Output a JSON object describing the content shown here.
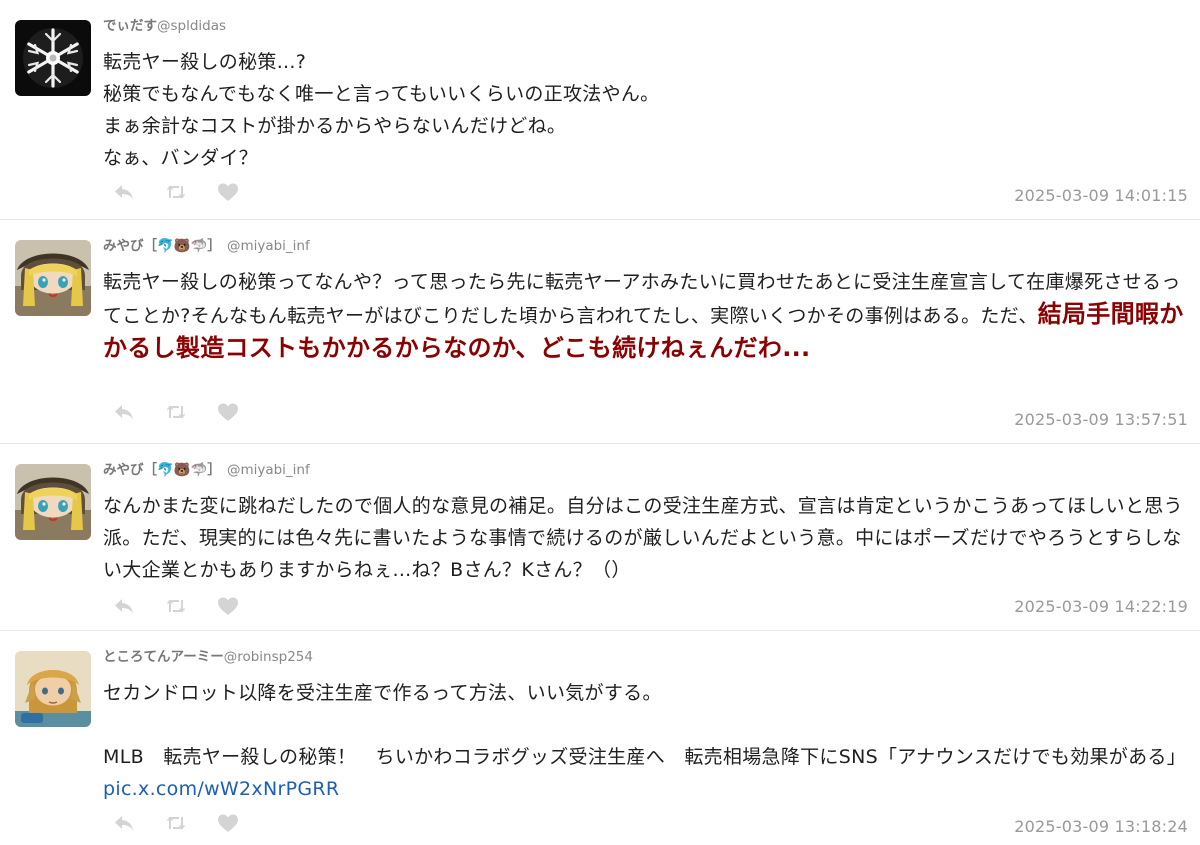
{
  "tweets": [
    {
      "user_name": "でぃだす",
      "user_emoji": "",
      "user_handle": "@spldidas",
      "lines": [
        "転売ヤー殺しの秘策...?",
        "秘策でもなんでもなく唯一と言ってもいいくらいの正攻法やん。",
        "まぁ余計なコストが掛かるからやらないんだけどね。",
        "なぁ、バンダイ？"
      ],
      "timestamp": "2025-03-09 14:01:15"
    },
    {
      "user_name": "みやび",
      "user_emoji": "［🐬🐻🦈］",
      "user_handle": "@miyabi_inf",
      "text_plain": "転売ヤー殺しの秘策ってなんや？って思ったら先に転売ヤーアホみたいに買わせたあとに受注生産宣言して在庫爆死させるってことか?そんなもん転売ヤーがはびこりだした頃から言われてたし、実際いくつかその事例はある。ただ、",
      "text_highlight": "結局手間暇かかるし製造コストもかかるからなのか、どこも続けねぇんだわ...",
      "timestamp": "2025-03-09 13:57:51"
    },
    {
      "user_name": "みやび",
      "user_emoji": "［🐬🐻🦈］",
      "user_handle": "@miyabi_inf",
      "text": "なんかまた変に跳ねだしたので個人的な意見の補足。自分はこの受注生産方式、宣言は肯定というかこうあってほしいと思う派。ただ、現実的には色々先に書いたような事情で続けるのが厳しいんだよという意。中にはポーズだけでやろうとすらしない大企業とかもありますからねぇ...ね？Bさん？Kさん？（）",
      "timestamp": "2025-03-09 14:22:19"
    },
    {
      "user_name": "ところてんアーミー",
      "user_emoji": "",
      "user_handle": "@robinsp254",
      "line1": "セカンドロット以降を受注生産で作るって方法、いい気がする。",
      "quote_text": "MLB　転売ヤー殺しの秘策！　ちいかわコラボグッズ受注生産へ　転売相場急降下にSNS「アナウンスだけでも効果がある」 ",
      "link_text": "pic.x.com/wW2xNrPGRR",
      "timestamp": "2025-03-09 13:18:24"
    }
  ],
  "icons": [
    "reply-icon",
    "retweet-icon",
    "like-icon"
  ],
  "colors": {
    "highlight": "#8b0000",
    "link": "#1a5fb4",
    "icon": "#d4d4d4",
    "meta": "#999999"
  }
}
